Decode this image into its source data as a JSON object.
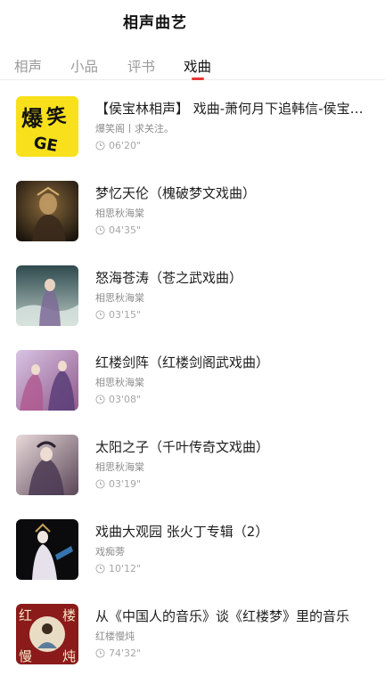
{
  "header": {
    "title": "相声曲艺"
  },
  "tabs": [
    {
      "label": "相声"
    },
    {
      "label": "小品"
    },
    {
      "label": "评书"
    },
    {
      "label": "戏曲"
    }
  ],
  "active_tab": "戏曲",
  "items": [
    {
      "title": "【侯宝林相声】 戏曲-萧何月下追韩信-侯宝林 郭全宝",
      "author": "爆笑阁丨求关注。",
      "duration": "06'20\"",
      "cover_text": "爆笑GE",
      "icon": "clock-icon"
    },
    {
      "title": "梦忆天伦（槐破梦文戏曲）",
      "author": "相思秋海棠",
      "duration": "04'35\"",
      "icon": "clock-icon"
    },
    {
      "title": "怒海苍涛（苍之武戏曲）",
      "author": "相思秋海棠",
      "duration": "03'15\"",
      "icon": "clock-icon"
    },
    {
      "title": "红楼剑阵（红楼剑阁武戏曲）",
      "author": "相思秋海棠",
      "duration": "03'08\"",
      "icon": "clock-icon"
    },
    {
      "title": "太阳之子（千叶传奇文戏曲）",
      "author": "相思秋海棠",
      "duration": "03'19\"",
      "icon": "clock-icon"
    },
    {
      "title": "戏曲大观园 张火丁专辑（2）",
      "author": "戏痴蒡",
      "duration": "10'12\"",
      "icon": "clock-icon"
    },
    {
      "title": "从《中国人的音乐》谈《红楼梦》里的音乐",
      "author": "红楼慢炖",
      "duration": "74'32\"",
      "cover_text": [
        "红",
        "楼",
        "慢",
        "炖"
      ],
      "icon": "clock-icon"
    }
  ],
  "colors": {
    "accent": "#e53935",
    "cover_yellow": "#f8e11c",
    "cover_red": "#8b1a1a"
  }
}
